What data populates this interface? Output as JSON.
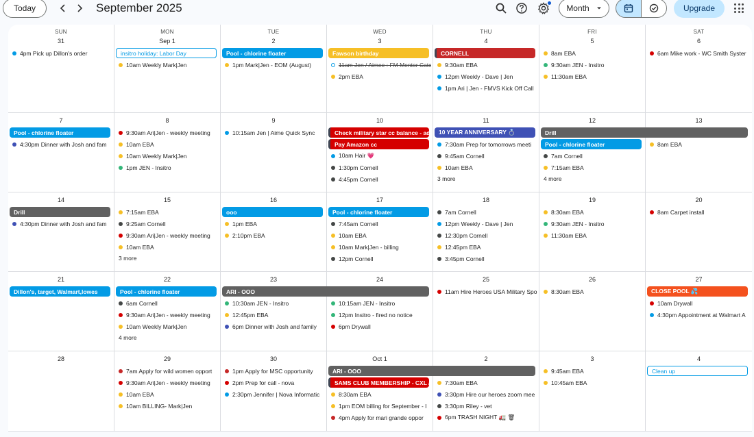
{
  "header": {
    "today_label": "Today",
    "prev_icon": "chevron-left-icon",
    "next_icon": "chevron-right-icon",
    "month_title": "September 2025",
    "view_label": "Month",
    "upgrade_label": "Upgrade"
  },
  "weekdays": [
    "SUN",
    "MON",
    "TUE",
    "WED",
    "THU",
    "FRI",
    "SAT"
  ],
  "colors": {
    "blue": "#039be5",
    "red": "#d50000",
    "dark": "#616161",
    "yellow": "#f6bf26",
    "navy": "#3f51b5",
    "green": "#33b679",
    "orange": "#f4511e",
    "darkred": "#c62828",
    "black": "#444746",
    "indigo": "#3f51b5"
  },
  "weeks": [
    {
      "days": [
        {
          "label": "31",
          "timed": [
            {
              "text": "4pm Pick up Dillon's order",
              "color": "blue"
            }
          ]
        },
        {
          "label": "Sep 1",
          "timed": [
            {
              "text": "10am Weekly Mark|Jen",
              "color": "yellow"
            }
          ]
        },
        {
          "label": "2",
          "timed": [
            {
              "text": "1pm Mark|Jen - EOM (August)",
              "color": "yellow"
            }
          ]
        },
        {
          "label": "3",
          "timed": [
            {
              "text": "11am Jen / Aimee : FM Mentor Catc",
              "color": "blue",
              "strike": true,
              "hollow": true
            },
            {
              "text": "2pm EBA",
              "color": "yellow"
            }
          ]
        },
        {
          "label": "4",
          "timed": [
            {
              "text": "9:30am EBA",
              "color": "yellow"
            },
            {
              "text": "12pm Weekly - Dave | Jen",
              "color": "blue"
            },
            {
              "text": "1pm Ari | Jen - FMVS Kick Off Call",
              "color": "blue"
            }
          ]
        },
        {
          "label": "5",
          "timed": [
            {
              "text": "8am EBA",
              "color": "yellow"
            },
            {
              "text": "9:30am JEN - Insitro",
              "color": "green"
            },
            {
              "text": "11:30am EBA",
              "color": "yellow"
            }
          ]
        },
        {
          "label": "6",
          "timed": [
            {
              "text": "6am Mike work - WC Smith Syster",
              "color": "red"
            }
          ]
        }
      ],
      "bars": [
        {
          "text": "insitro holiday: Labor Day",
          "start": 1,
          "span": 1,
          "row": 0,
          "style": "outline"
        },
        {
          "text": "Pool - chlorine floater",
          "start": 2,
          "span": 1,
          "row": 0,
          "color": "blue"
        },
        {
          "text": "Fawson birthday",
          "start": 3,
          "span": 1,
          "row": 0,
          "color": "yellow"
        },
        {
          "text": "CORNELL",
          "start": 4,
          "span": 1,
          "row": 0,
          "color": "darkred",
          "edge": true
        }
      ]
    },
    {
      "days": [
        {
          "label": "7",
          "timed": [
            {
              "text": "4:30pm Dinner with Josh and fam",
              "color": "navy"
            }
          ]
        },
        {
          "label": "8",
          "timed": [
            {
              "text": "9:30am Ari|Jen - weekly meeting",
              "color": "red"
            },
            {
              "text": "10am EBA",
              "color": "yellow"
            },
            {
              "text": "10am Weekly Mark|Jen",
              "color": "yellow"
            },
            {
              "text": "1pm JEN - Insitro",
              "color": "green"
            }
          ]
        },
        {
          "label": "9",
          "timed": [
            {
              "text": "10:15am Jen | Aime Quick Sync",
              "color": "blue"
            }
          ]
        },
        {
          "label": "10",
          "timed": [
            {
              "text": "10am Hair 💗",
              "color": "blue"
            },
            {
              "text": "1:30pm Cornell",
              "color": "black"
            },
            {
              "text": "4:45pm Cornell",
              "color": "black"
            }
          ]
        },
        {
          "label": "11",
          "timed": [
            {
              "text": "7:30am Prep for tomorrows meeti",
              "color": "blue"
            },
            {
              "text": "9:45am Cornell",
              "color": "black"
            },
            {
              "text": "10am EBA",
              "color": "yellow"
            }
          ],
          "more": "3 more"
        },
        {
          "label": "12",
          "timed": [
            {
              "text": "7am Cornell",
              "color": "black"
            },
            {
              "text": "7:15am EBA",
              "color": "yellow"
            }
          ],
          "more": "4 more"
        },
        {
          "label": "13",
          "timed": [
            {
              "text": "8am EBA",
              "color": "yellow"
            }
          ]
        }
      ],
      "bars": [
        {
          "text": "Pool - chlorine floater",
          "start": 0,
          "span": 1,
          "row": 0,
          "color": "blue"
        },
        {
          "text": "Check military star cc balance - ad",
          "start": 3,
          "span": 1,
          "row": 0,
          "color": "red",
          "edge": true
        },
        {
          "text": "Pay Amazon cc",
          "start": 3,
          "span": 1,
          "row": 1,
          "color": "red",
          "edge": true
        },
        {
          "text": "10 YEAR ANNIVERSARY 💍",
          "start": 4,
          "span": 1,
          "row": 0,
          "color": "navy"
        },
        {
          "text": "Drill",
          "start": 5,
          "span": 2,
          "row": 0,
          "color": "dark"
        },
        {
          "text": "Pool - chlorine floater",
          "start": 5,
          "span": 1,
          "row": 1,
          "color": "blue"
        }
      ]
    },
    {
      "days": [
        {
          "label": "14",
          "timed": [
            {
              "text": "4:30pm Dinner with Josh and fam",
              "color": "navy"
            }
          ]
        },
        {
          "label": "15",
          "timed": [
            {
              "text": "7:15am EBA",
              "color": "yellow"
            },
            {
              "text": "9:25am Cornell",
              "color": "black"
            },
            {
              "text": "9:30am Ari|Jen - weekly meeting",
              "color": "red"
            },
            {
              "text": "10am EBA",
              "color": "yellow"
            }
          ],
          "more": "3 more"
        },
        {
          "label": "16",
          "timed": [
            {
              "text": "1pm EBA",
              "color": "yellow"
            },
            {
              "text": "2:10pm EBA",
              "color": "yellow"
            }
          ]
        },
        {
          "label": "17",
          "timed": [
            {
              "text": "7:45am Cornell",
              "color": "black"
            },
            {
              "text": "10am EBA",
              "color": "yellow"
            },
            {
              "text": "10am Mark|Jen - billing",
              "color": "yellow"
            },
            {
              "text": "12pm Cornell",
              "color": "black"
            }
          ]
        },
        {
          "label": "18",
          "timed": [
            {
              "text": "7am Cornell",
              "color": "black"
            },
            {
              "text": "12pm Weekly - Dave | Jen",
              "color": "blue"
            },
            {
              "text": "12:30pm Cornell",
              "color": "black"
            },
            {
              "text": "12:45pm EBA",
              "color": "yellow"
            },
            {
              "text": "3:45pm Cornell",
              "color": "black"
            }
          ]
        },
        {
          "label": "19",
          "timed": [
            {
              "text": "8:30am EBA",
              "color": "yellow"
            },
            {
              "text": "9:30am JEN - Insitro",
              "color": "green"
            },
            {
              "text": "11:30am EBA",
              "color": "yellow"
            }
          ]
        },
        {
          "label": "20",
          "timed": [
            {
              "text": "8am Carpet install",
              "color": "red"
            }
          ]
        }
      ],
      "bars": [
        {
          "text": "Drill",
          "start": 0,
          "span": 1,
          "row": 0,
          "color": "dark"
        },
        {
          "text": "ooo",
          "start": 2,
          "span": 1,
          "row": 0,
          "color": "blue"
        },
        {
          "text": "Pool - chlorine floater",
          "start": 3,
          "span": 1,
          "row": 0,
          "color": "blue"
        }
      ]
    },
    {
      "days": [
        {
          "label": "21",
          "timed": []
        },
        {
          "label": "22",
          "timed": [
            {
              "text": "6am Cornell",
              "color": "black"
            },
            {
              "text": "9:30am Ari|Jen - weekly meeting",
              "color": "red"
            },
            {
              "text": "10am Weekly Mark|Jen",
              "color": "yellow"
            }
          ],
          "more": "4 more"
        },
        {
          "label": "23",
          "timed": [
            {
              "text": "10:30am JEN - Insitro",
              "color": "green"
            },
            {
              "text": "12:45pm EBA",
              "color": "yellow"
            },
            {
              "text": "6pm Dinner with Josh and family",
              "color": "navy"
            }
          ]
        },
        {
          "label": "24",
          "timed": [
            {
              "text": "10:15am JEN - Insitro",
              "color": "green"
            },
            {
              "text": "12pm Insitro - fired no notice",
              "color": "green"
            },
            {
              "text": "6pm Drywall",
              "color": "red"
            }
          ]
        },
        {
          "label": "25",
          "timed": [
            {
              "text": "11am Hire Heroes USA Military Spo",
              "color": "red"
            }
          ]
        },
        {
          "label": "26",
          "timed": [
            {
              "text": "8:30am EBA",
              "color": "yellow"
            }
          ]
        },
        {
          "label": "27",
          "timed": [
            {
              "text": "10am Drywall",
              "color": "red"
            },
            {
              "text": "4:30pm Appointment at Walmart A",
              "color": "blue"
            }
          ]
        }
      ],
      "bars": [
        {
          "text": "Dillon's, target, Walmart,lowes",
          "start": 0,
          "span": 1,
          "row": 0,
          "color": "blue"
        },
        {
          "text": "Pool - chlorine floater",
          "start": 1,
          "span": 1,
          "row": 0,
          "color": "blue"
        },
        {
          "text": "ARI - OOO",
          "start": 2,
          "span": 2,
          "row": 0,
          "color": "dark"
        },
        {
          "text": "CLOSE POOL 💦",
          "start": 6,
          "span": 1,
          "row": 0,
          "color": "orange"
        }
      ]
    },
    {
      "days": [
        {
          "label": "28",
          "timed": []
        },
        {
          "label": "29",
          "timed": [
            {
              "text": "7am Apply for wild women opport",
              "color": "darkred"
            },
            {
              "text": "9:30am Ari|Jen - weekly meeting",
              "color": "red"
            },
            {
              "text": "10am EBA",
              "color": "yellow"
            },
            {
              "text": "10am BILLING- Mark|Jen",
              "color": "yellow"
            }
          ]
        },
        {
          "label": "30",
          "timed": [
            {
              "text": "1pm Apply for MSC opportunity",
              "color": "darkred"
            },
            {
              "text": "2pm Prep for call - nova",
              "color": "red"
            },
            {
              "text": "2:30pm Jennifer | Nova Informatic",
              "color": "blue"
            }
          ]
        },
        {
          "label": "Oct 1",
          "timed": [
            {
              "text": "8:30am EBA",
              "color": "yellow"
            },
            {
              "text": "1pm EOM billing for September - I",
              "color": "yellow"
            },
            {
              "text": "4pm Apply for mari grande oppor",
              "color": "darkred"
            }
          ]
        },
        {
          "label": "2",
          "timed": [
            {
              "text": "7:30am EBA",
              "color": "yellow"
            },
            {
              "text": "3:30pm Hire our heroes zoom mee",
              "color": "indigo"
            },
            {
              "text": "3:30pm Riley - vet",
              "color": "black"
            },
            {
              "text": "6pm TRASH NIGHT 🚛 🗑",
              "color": "red"
            }
          ]
        },
        {
          "label": "3",
          "timed": [
            {
              "text": "9:45am EBA",
              "color": "yellow"
            },
            {
              "text": "10:45am EBA",
              "color": "yellow"
            }
          ]
        },
        {
          "label": "4",
          "timed": []
        }
      ],
      "bars": [
        {
          "text": "ARI - OOO",
          "start": 3,
          "span": 2,
          "row": 0,
          "color": "dark"
        },
        {
          "text": "SAMS CLUB MEMBERSHIP - CXL / I",
          "start": 3,
          "span": 1,
          "row": 1,
          "color": "red",
          "edge": true
        },
        {
          "text": "Clean up",
          "start": 6,
          "span": 1,
          "row": 0,
          "style": "outline"
        }
      ]
    }
  ]
}
